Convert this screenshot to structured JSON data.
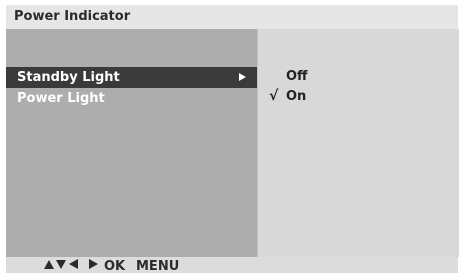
{
  "title": "Power Indicator",
  "menu": {
    "items": [
      {
        "label": "Standby Light",
        "selected": true
      },
      {
        "label": "Power Light",
        "selected": false
      }
    ]
  },
  "options": {
    "items": [
      {
        "label": "Off",
        "checked": false,
        "check_mark": ""
      },
      {
        "label": "On",
        "checked": true,
        "check_mark": "√"
      }
    ]
  },
  "footer": {
    "nav_icons": [
      "up-arrow-icon",
      "down-arrow-icon",
      "left-arrow-icon",
      "right-arrow-icon"
    ],
    "ok_label": "OK",
    "menu_label": "MENU"
  },
  "colors": {
    "title_bar": "#e6e6e6",
    "left_panel": "#adadad",
    "right_panel": "#d8d8d8",
    "selected_item": "#3a3a3a"
  }
}
